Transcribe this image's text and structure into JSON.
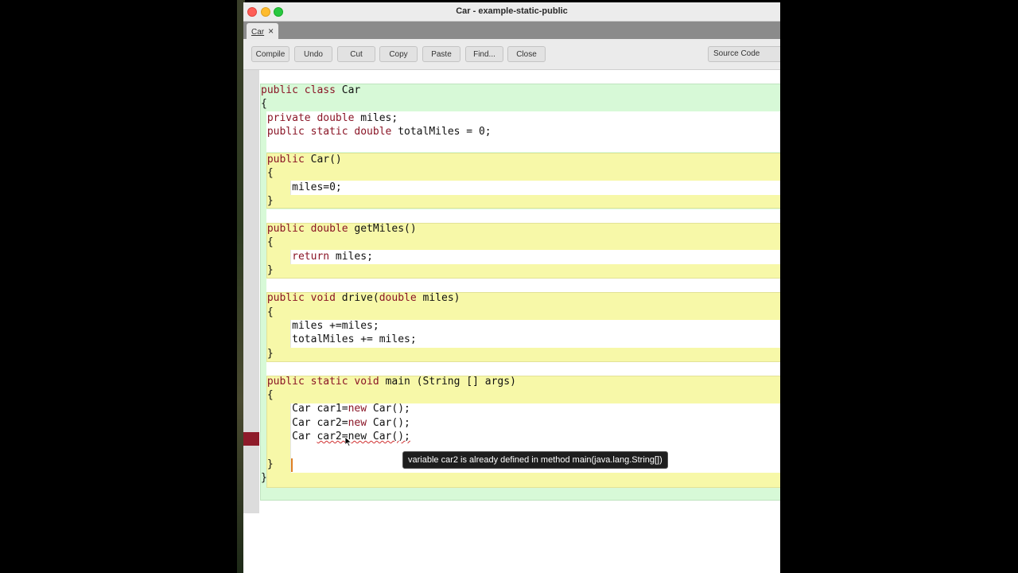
{
  "window": {
    "title": "Car - example-static-public"
  },
  "tabs": [
    {
      "label": "Car",
      "close_icon": "×"
    }
  ],
  "toolbar": {
    "buttons": [
      "Compile",
      "Undo",
      "Cut",
      "Copy",
      "Paste",
      "Find...",
      "Close"
    ],
    "view_select": "Source Code"
  },
  "editor": {
    "lines": {
      "l1": {
        "kw": "public class",
        "rest": " Car"
      },
      "l2": {
        "text": "{"
      },
      "l3": {
        "kw": "private double",
        "rest": " miles;"
      },
      "l4": {
        "kw1": "public static double",
        "rest": " totalMiles = 0;"
      },
      "l6": {
        "kw": "public",
        "rest": " Car()"
      },
      "l7": {
        "text": "{"
      },
      "l8": {
        "text": "miles=0;"
      },
      "l9": {
        "text": "}"
      },
      "l11": {
        "kw": "public double",
        "rest": " getMiles()"
      },
      "l12": {
        "text": "{"
      },
      "l13": {
        "kw": "return",
        "rest": " miles;"
      },
      "l14": {
        "text": "}"
      },
      "l16": {
        "kw": "public void",
        "mid": " drive(",
        "kw2": "double",
        "rest": " miles)"
      },
      "l17": {
        "text": "{"
      },
      "l18": {
        "text": "miles +=miles;"
      },
      "l19": {
        "text": "totalMiles += miles;"
      },
      "l20": {
        "text": "}"
      },
      "l22": {
        "kw": "public static void",
        "rest": " main (String [] args)"
      },
      "l23": {
        "text": "{"
      },
      "l24": {
        "a": "Car car1=",
        "kw": "new",
        "b": " Car();"
      },
      "l25": {
        "a": "Car car2=",
        "kw": "new",
        "b": " Car();"
      },
      "l26": {
        "a": "Car ",
        "err": "car2=new Car();"
      },
      "l28": {
        "text": "}"
      },
      "l29": {
        "text": "}"
      }
    },
    "error_tooltip": "variable car2 is already defined in method main(java.lang.String[])"
  },
  "colors": {
    "keyword": "#8a1526",
    "class_scope": "#d7f9d7",
    "method_scope": "#f7f8a8",
    "error_marker": "#8e1b2a"
  }
}
